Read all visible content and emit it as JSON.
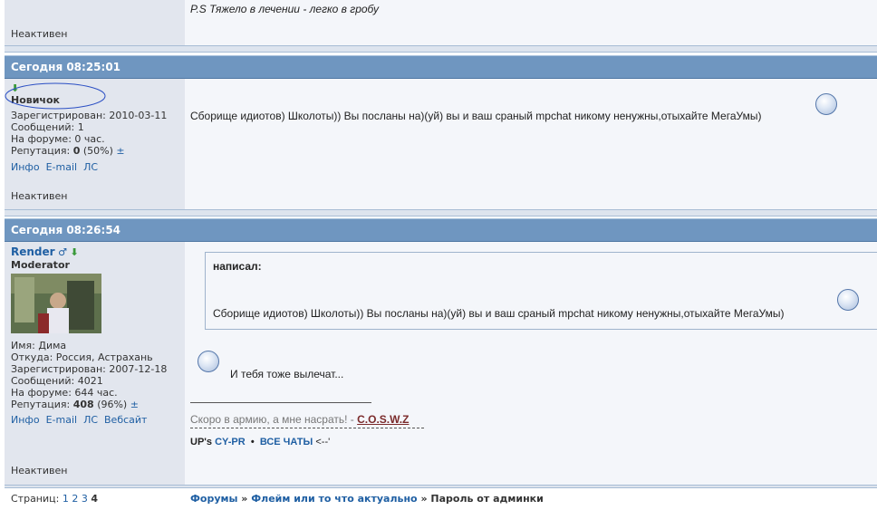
{
  "post0": {
    "quote_line": "P.S Тяжело в лечении - легко в гробу",
    "status": "Неактивен"
  },
  "post1": {
    "header": "Сегодня 08:25:01",
    "rank": "Новичок",
    "registered": "Зарегистрирован: 2010-03-11",
    "messages": "Сообщений: 1",
    "on_forum": "На форуме: 0 час.",
    "reputation_label": "Репутация:",
    "reputation_value": "0",
    "reputation_pct": "(50%)",
    "reputation_pm": "±",
    "links": [
      "Инфо",
      "E-mail",
      "ЛС"
    ],
    "message": "Сборище идиотов) Школоты)) Вы посланы на)(уй) вы и ваш сраный mpchat никому ненужны,отыхайте МегаУмы)",
    "status": "Неактивен"
  },
  "post2": {
    "header": "Сегодня 08:26:54",
    "username": "Render",
    "gender_icon": "♂",
    "rank": "Moderator",
    "name": "Имя: Дима",
    "from": "Откуда: Россия, Астрахань",
    "registered": "Зарегистрирован: 2007-12-18",
    "messages": "Сообщений: 4021",
    "on_forum": "На форуме: 644 час.",
    "reputation_label": "Репутация:",
    "reputation_value": "408",
    "reputation_pct": "(96%)",
    "reputation_pm": "±",
    "links": [
      "Инфо",
      "E-mail",
      "ЛС",
      "Вебсайт"
    ],
    "quote_author": "написал:",
    "quote_text": "Сборище идиотов) Школоты)) Вы посланы на)(уй) вы и ваш сраный mpchat никому ненужны,отыхайте МегаУмы)",
    "reply": "И тебя тоже вылечат...",
    "sig_text": "Скоро в армию, а мне насрать! -",
    "sig_link": "C.O.S.W.Z",
    "sig2_prefix": "UP's",
    "sig2_link1": "CY-PR",
    "sig2_bullet": "•",
    "sig2_link2": "ВСЕ ЧАТЫ",
    "sig2_suffix": "<--'",
    "status": "Неактивен"
  },
  "footer": {
    "pages_label": "Страниц:",
    "pages": [
      "1",
      "2",
      "3"
    ],
    "current_page": "4",
    "crumb1": "Форумы",
    "sep": "»",
    "crumb2": "Флейм или то что актуально",
    "crumb3": "Пароль от админки"
  },
  "colors": {
    "header_bg": "#6f96c0",
    "left_col_bg": "#e2e6ee",
    "link": "#1f5fa3",
    "annotation": "#2b4fc4"
  }
}
